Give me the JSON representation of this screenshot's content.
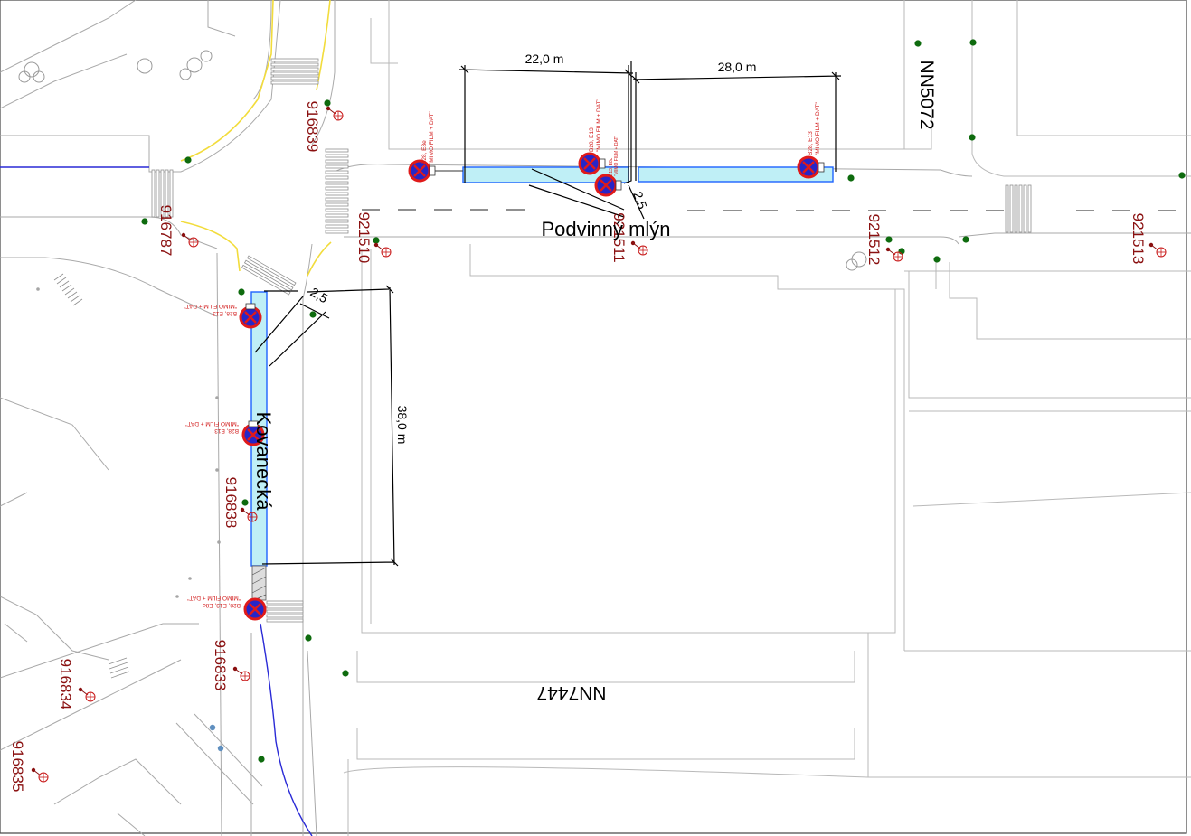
{
  "map": {
    "dimensions": {
      "top_left": "22,0 m",
      "top_right": "28,0 m",
      "left_vertical": "38,0 m",
      "small_a": "2,5",
      "small_b": "2,5"
    },
    "streets": {
      "podvinny": "Podvinný mlýn",
      "kovanecka": "Kovanecká"
    },
    "areas": {
      "nn5072": "NN5072",
      "nn7447": "NN7447"
    },
    "points": {
      "p916839": "916839",
      "p916787": "916787",
      "p921510": "921510",
      "p921511": "921511",
      "p921512": "921512",
      "p921513": "921513",
      "p916838": "916838",
      "p916833": "916833",
      "p916834": "916834",
      "p916835": "916835"
    },
    "signs": {
      "s1_line1": "B28, E8e",
      "s1_line2": "\"MIMO FILM + DAT\"",
      "s2_line1": "B28, E13",
      "s2_line2": "\"MIMO FILM + DAT\"",
      "s3_line1": "E13, E8c",
      "s3_line2": "\"MIMO FILM + DAT\"",
      "s4_line1": "B28, E13",
      "s4_line2": "\"MIMO FILM + DAT\"",
      "s5_line1": "B28, E13",
      "s5_line2": "\"MIMO FILM + DAT\"",
      "s6_line1": "B28, E13",
      "s6_line2": "\"MIMO FILM + DAT\"",
      "s7_line1": "B28, E13, E8c",
      "s7_line2": "\"MIMO FILM + DAT\""
    },
    "colors": {
      "zone_fill": "#bfeff6",
      "zone_stroke": "#1e63ff",
      "sign_red": "#e01a1a",
      "sign_blue": "#2626c8",
      "tree": "#0e6b0e",
      "label": "#8a1010"
    }
  }
}
